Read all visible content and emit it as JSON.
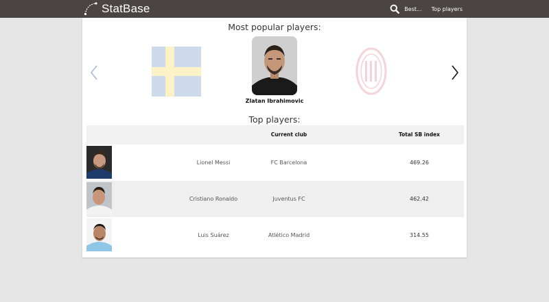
{
  "header": {
    "brand": "StatBase",
    "nav": [
      "Best...",
      "Top players"
    ],
    "icons": [
      "logo-icon",
      "search-icon"
    ]
  },
  "popular": {
    "title": "Most popular players:",
    "featured_player": "Zlatan Ibrahimovic",
    "side_items": [
      "sweden-flag",
      "ac-milan-logo"
    ]
  },
  "top_players": {
    "title": "Top players:",
    "columns": [
      "",
      "",
      "Current club",
      "Total SB index"
    ],
    "rows": [
      {
        "name": "Lionel Messi",
        "club": "FC Barcelona",
        "index": "469.26"
      },
      {
        "name": "Cristiano Ronaldo",
        "club": "Juventus FC",
        "index": "462.42"
      },
      {
        "name": "Luis Suárez",
        "club": "Atlético Madrid",
        "index": "314.55"
      }
    ]
  },
  "colors": {
    "navbar": "#4a4544",
    "page_background": "#e6e6e6",
    "panel": "#ffffff",
    "table_header": "#f1f1f1",
    "row_alt": "#efefef"
  }
}
